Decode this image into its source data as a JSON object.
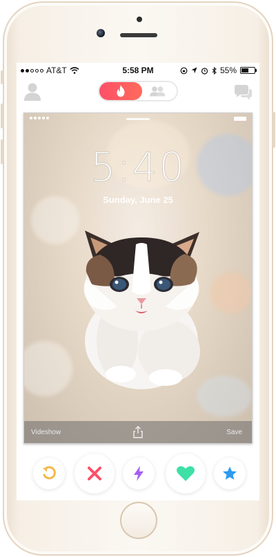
{
  "device": {
    "model_color": "#f6efe5"
  },
  "status_bar": {
    "carrier": "AT&T",
    "time": "5:58 PM",
    "battery_percent_label": "55%",
    "battery_level": 0.55,
    "signal_bars": 2,
    "icons": [
      "signal-dots-icon",
      "wifi-icon",
      "lock-rotation-icon",
      "location-icon",
      "alarm-icon",
      "bluetooth-icon",
      "battery-icon"
    ]
  },
  "app_header": {
    "left_icon": "profile-icon",
    "right_icon": "messages-icon",
    "toggle": {
      "active": "flame-icon",
      "inactive": "group-icon",
      "active_color": "#fd4f68"
    }
  },
  "card": {
    "lockscreen_time": "5:40",
    "lockscreen_date": "Sunday, June 25",
    "bar_left_label": "Videshow",
    "bar_right_label": "Save",
    "bar_center_icon": "share-icon"
  },
  "actions": [
    {
      "name": "rewind",
      "icon": "undo-icon",
      "color": "#f5b748"
    },
    {
      "name": "nope",
      "icon": "close-icon",
      "color": "#fd5068"
    },
    {
      "name": "boost",
      "icon": "lightning-icon",
      "color": "#a55ff4"
    },
    {
      "name": "like",
      "icon": "heart-icon",
      "color": "#3ee0a6"
    },
    {
      "name": "super-like",
      "icon": "star-icon",
      "color": "#2c9bf0"
    }
  ]
}
